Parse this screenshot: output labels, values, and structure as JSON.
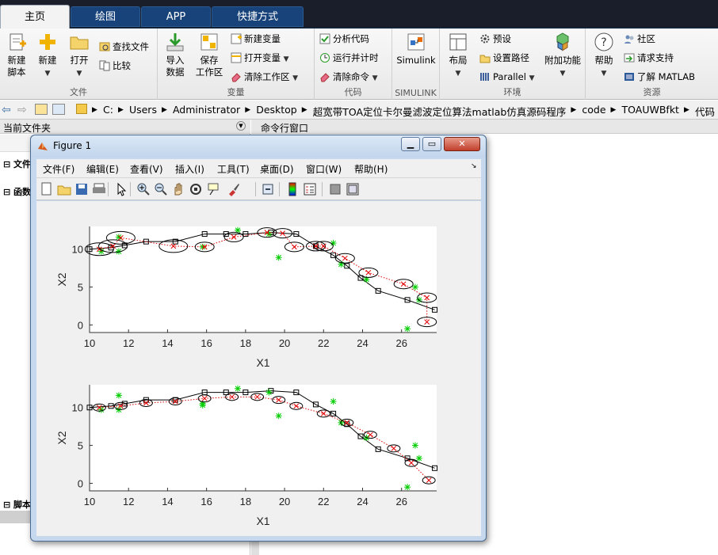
{
  "tabs": [
    {
      "label": "主页",
      "active": true
    },
    {
      "label": "绘图",
      "active": false
    },
    {
      "label": "APP",
      "active": false
    },
    {
      "label": "快捷方式",
      "active": false
    }
  ],
  "ribbon": {
    "file": {
      "label": "文件",
      "new_script": "新建\n脚本",
      "new": "新建",
      "open": "打开",
      "find_files": "查找文件",
      "compare": "比较"
    },
    "variable": {
      "label": "变量",
      "import": "导入\n数据",
      "save_ws": "保存\n工作区",
      "new_var": "新建变量",
      "open_var": "打开变量",
      "clear_ws": "清除工作区"
    },
    "code": {
      "label": "代码",
      "analyze": "分析代码",
      "run_time": "运行并计时",
      "clear_cmd": "清除命令"
    },
    "simulink": {
      "label": "SIMULINK",
      "button": "Simulink"
    },
    "env": {
      "label": "环境",
      "layout": "布局",
      "prefs": "预设",
      "set_path": "设置路径",
      "parallel": "Parallel",
      "addons": "附加功能"
    },
    "resources": {
      "label": "资源",
      "help": "帮助",
      "community": "社区",
      "support": "请求支持",
      "learn": "了解 MATLAB"
    }
  },
  "address": {
    "crumbs": [
      "C:",
      "Users",
      "Administrator",
      "Desktop",
      "超宽带TOA定位卡尔曼滤波定位算法matlab仿真源码程序",
      "code",
      "TOAUWBfkt",
      "代码"
    ]
  },
  "panels": {
    "current_folder": "当前文件夹",
    "command_window": "命令行窗口",
    "section_file": "文件",
    "section_func": "函数",
    "section_script": "脚本"
  },
  "figure": {
    "title": "Figure 1",
    "menu": [
      "文件(F)",
      "编辑(E)",
      "查看(V)",
      "插入(I)",
      "工具(T)",
      "桌面(D)",
      "窗口(W)",
      "帮助(H)"
    ],
    "toolbar_icons": [
      "new-figure-icon",
      "open-icon",
      "save-icon",
      "print-icon",
      "pointer-icon",
      "zoom-in-icon",
      "zoom-out-icon",
      "pan-icon",
      "rotate-icon",
      "data-cursor-icon",
      "brush-icon",
      "link-icon",
      "colorbar-icon",
      "legend-icon",
      "hide-plot-tools-icon",
      "show-plot-tools-icon"
    ]
  },
  "chart_data": [
    {
      "type": "line",
      "title": "",
      "xlabel": "X1",
      "ylabel": "X2",
      "xlim": [
        10,
        27.8
      ],
      "ylim": [
        -1,
        13
      ],
      "xticks": [
        10,
        12,
        14,
        16,
        18,
        20,
        22,
        24,
        26
      ],
      "yticks": [
        0,
        5,
        10
      ],
      "series": [
        {
          "style": "true-path",
          "color": "#000000",
          "x": [
            10,
            11.1,
            11.8,
            12.9,
            14.4,
            15.9,
            17.0,
            18.0,
            19.3,
            20.6,
            21.6,
            22.5,
            23.2,
            23.9,
            24.8,
            26.3,
            27.7
          ],
          "y": [
            10.0,
            10.2,
            10.5,
            11.0,
            11.0,
            12.0,
            12.0,
            12.0,
            12.2,
            12.0,
            10.4,
            9.2,
            7.8,
            6.2,
            4.5,
            3.3,
            2.0
          ]
        },
        {
          "style": "measurement",
          "color": "#00cc00",
          "x": [
            10.6,
            11.5,
            11.5,
            15.8,
            17.6,
            19.2,
            19.7,
            22.5,
            22.9,
            24.2,
            26.7,
            26.9,
            26.3
          ],
          "y": [
            9.7,
            11.6,
            9.7,
            10.3,
            12.5,
            12.0,
            8.9,
            10.8,
            8.0,
            6.0,
            5.0,
            3.3,
            -0.5
          ]
        },
        {
          "style": "estimate",
          "color": "#e00000",
          "x": [
            10.5,
            11.2,
            11.6,
            14.3,
            15.9,
            17.4,
            19.1,
            19.9,
            20.5,
            21.6,
            22.0,
            23.1,
            24.3,
            26.1,
            27.3,
            27.3
          ],
          "y": [
            10.0,
            10.4,
            11.5,
            10.4,
            10.3,
            11.6,
            12.2,
            12.1,
            10.3,
            10.4,
            10.4,
            8.8,
            6.9,
            5.4,
            3.6,
            0.4
          ]
        }
      ]
    },
    {
      "type": "line",
      "title": "",
      "xlabel": "X1",
      "ylabel": "X2",
      "xlim": [
        10,
        27.8
      ],
      "ylim": [
        -1,
        13
      ],
      "xticks": [
        10,
        12,
        14,
        16,
        18,
        20,
        22,
        24,
        26
      ],
      "yticks": [
        0,
        5,
        10
      ],
      "series": [
        {
          "style": "true-path",
          "color": "#000000",
          "x": [
            10,
            11.1,
            11.8,
            12.9,
            14.4,
            15.9,
            17.0,
            18.0,
            19.3,
            20.6,
            21.6,
            22.5,
            23.2,
            23.9,
            24.8,
            26.3,
            27.7
          ],
          "y": [
            10.0,
            10.2,
            10.5,
            11.0,
            11.0,
            12.0,
            12.0,
            12.0,
            12.2,
            12.0,
            10.4,
            9.2,
            7.8,
            6.2,
            4.5,
            3.3,
            2.0
          ]
        },
        {
          "style": "measurement",
          "color": "#00cc00",
          "x": [
            10.6,
            11.5,
            11.5,
            15.8,
            15.8,
            17.6,
            19.2,
            19.7,
            22.5,
            22.9,
            24.2,
            26.7,
            26.9,
            26.3
          ],
          "y": [
            9.7,
            11.6,
            9.7,
            10.5,
            10.3,
            12.5,
            12.0,
            8.9,
            10.8,
            8.0,
            6.0,
            5.0,
            3.3,
            -0.5
          ]
        },
        {
          "style": "estimate",
          "color": "#e00000",
          "x": [
            10.5,
            11.6,
            12.9,
            14.4,
            15.9,
            17.3,
            18.6,
            19.7,
            20.6,
            22.0,
            23.2,
            24.4,
            25.6,
            26.5,
            27.4
          ],
          "y": [
            10.0,
            10.2,
            10.6,
            10.8,
            11.2,
            11.4,
            11.4,
            11.0,
            10.2,
            9.2,
            8.0,
            6.4,
            4.6,
            2.7,
            0.4
          ]
        }
      ]
    }
  ],
  "colors": {
    "titlebar": "#1a1e2a",
    "tab_blue": "#17427a",
    "true_path": "#000000",
    "measurement": "#00cc00",
    "estimate": "#e00000"
  }
}
